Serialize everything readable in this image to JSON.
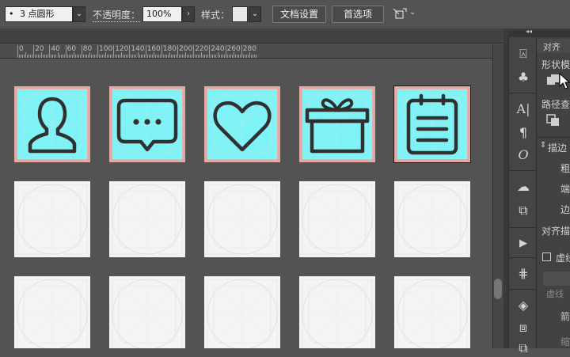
{
  "options_bar": {
    "brush": {
      "dot": "•",
      "value": "3 点圆形"
    },
    "opacity": {
      "label": "不透明度：",
      "value": "100%"
    },
    "style_label": "样式：",
    "doc_setup_button": "文档设置",
    "preferences_button": "首选项"
  },
  "ruler": {
    "ticks": [
      "0",
      "20",
      "40",
      "60",
      "80",
      "100",
      "120",
      "140",
      "160",
      "180",
      "200",
      "220",
      "240",
      "260",
      "280"
    ]
  },
  "canvas": {
    "row1_icons": [
      "user-icon",
      "chat-bubble-icon",
      "heart-icon",
      "gift-icon",
      "clipboard-icon"
    ]
  },
  "panel": {
    "collapse_glyph": "◂◂",
    "tab_label": "对齐",
    "shape_mode_label": "形状模",
    "pathfinder_label": "路径查",
    "stroke_header": "描边",
    "weight_label": "粗",
    "cap_label": "端",
    "corner_label": "边",
    "align_stroke_label": "对齐描",
    "dashed_label": "虚线",
    "dashed_sub": "虚线",
    "dash_label": "箭",
    "gap_label": "缩"
  },
  "colors": {
    "icon_fill": "#7ff2f5",
    "icon_border": "#e5a9a5",
    "icon_stroke": "#303030",
    "artboard": "#f4f4f4",
    "ui_bg": "#535353"
  }
}
